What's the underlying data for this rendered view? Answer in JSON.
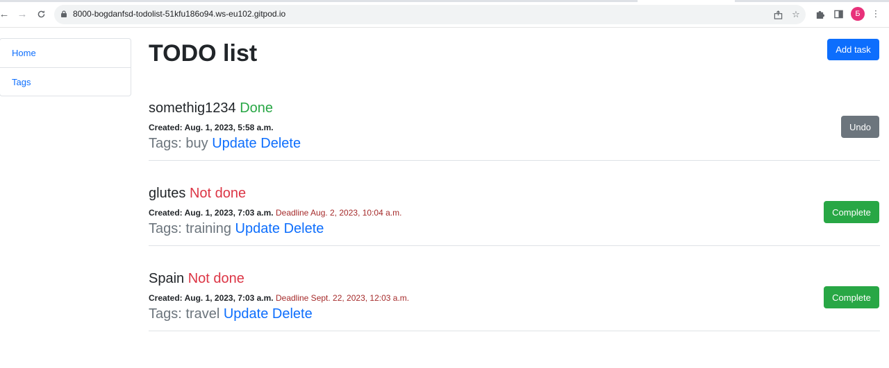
{
  "browser": {
    "url": "8000-bogdanfsd-todolist-51kfu186o94.ws-eu102.gitpod.io",
    "profile_initial": "Б",
    "colors": {
      "profile": "#e8317a"
    }
  },
  "sidebar": {
    "items": [
      {
        "label": "Home"
      },
      {
        "label": "Tags"
      }
    ]
  },
  "page": {
    "title": "TODO list",
    "add_task_label": "Add task"
  },
  "tasks": [
    {
      "name": "somethig1234",
      "status": "Done",
      "created": "Created: Aug. 1, 2023, 5:58 a.m.",
      "deadline": "",
      "tags_label": "Tags:",
      "tags": "buy",
      "update_label": "Update",
      "delete_label": "Delete",
      "action_label": "Undo"
    },
    {
      "name": "glutes",
      "status": "Not done",
      "created": "Created: Aug. 1, 2023, 7:03 a.m.",
      "deadline": "Deadline Aug. 2, 2023, 10:04 a.m.",
      "tags_label": "Tags:",
      "tags": "training",
      "update_label": "Update",
      "delete_label": "Delete",
      "action_label": "Complete"
    },
    {
      "name": "Spain",
      "status": "Not done",
      "created": "Created: Aug. 1, 2023, 7:03 a.m.",
      "deadline": "Deadline Sept. 22, 2023, 12:03 a.m.",
      "tags_label": "Tags:",
      "tags": "travel",
      "update_label": "Update",
      "delete_label": "Delete",
      "action_label": "Complete"
    }
  ],
  "colors": {
    "primary": "#0d6efd",
    "success": "#28a745",
    "danger": "#dc3545",
    "secondary": "#6c757d",
    "deadline": "#a52a2a"
  }
}
